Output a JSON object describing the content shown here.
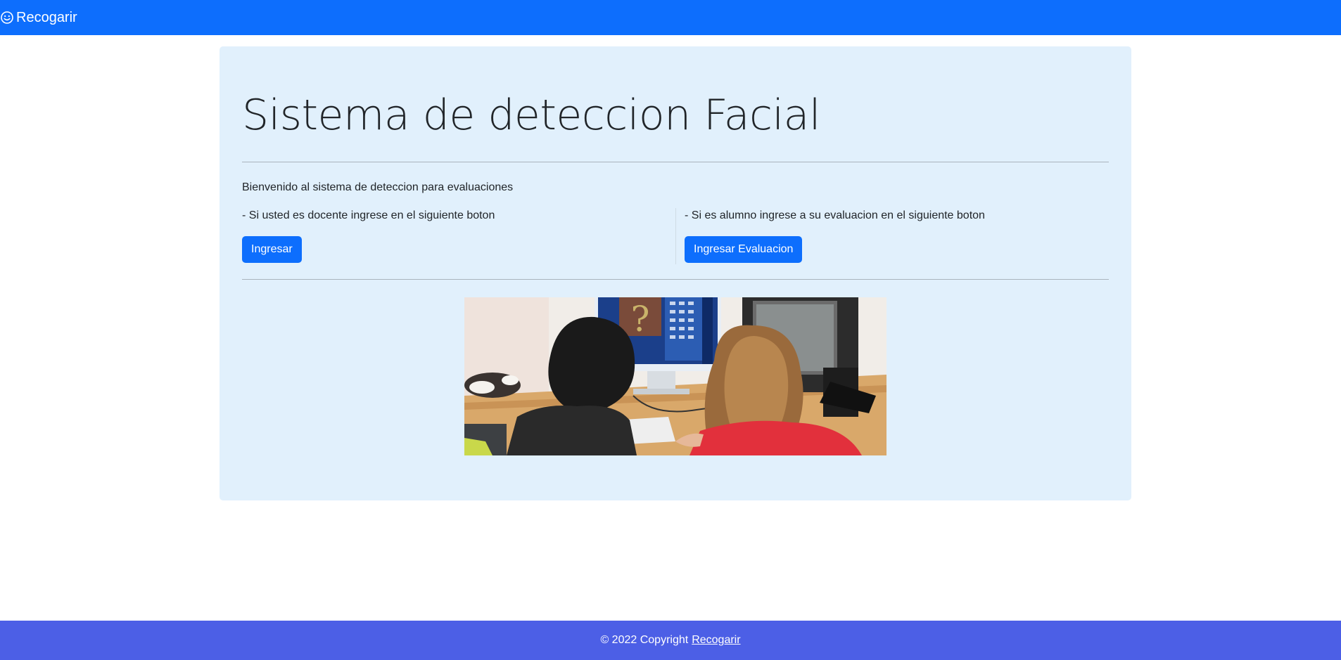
{
  "navbar": {
    "brand_label": "Recogarir",
    "brand_icon": "smiley-face-icon",
    "background": "#0d6efd"
  },
  "main": {
    "title": "Sistema de deteccion Facial",
    "welcome": "Bienvenido al sistema de deteccion para evaluaciones",
    "left": {
      "text": "- Si usted es docente ingrese en el siguiente boton",
      "button_label": "Ingresar"
    },
    "right": {
      "text": "- Si es alumno ingrese a su evaluacion en el siguiente boton",
      "button_label": "Ingresar Evaluacion"
    },
    "image": {
      "alt": "Dos estudiantes frente a computadoras"
    },
    "background": "#e1f0fc"
  },
  "footer": {
    "text": "© 2022 Copyright",
    "link_label": "Recogarir",
    "background": "#4c5fe6"
  },
  "colors": {
    "accent": "#0d6efd"
  }
}
